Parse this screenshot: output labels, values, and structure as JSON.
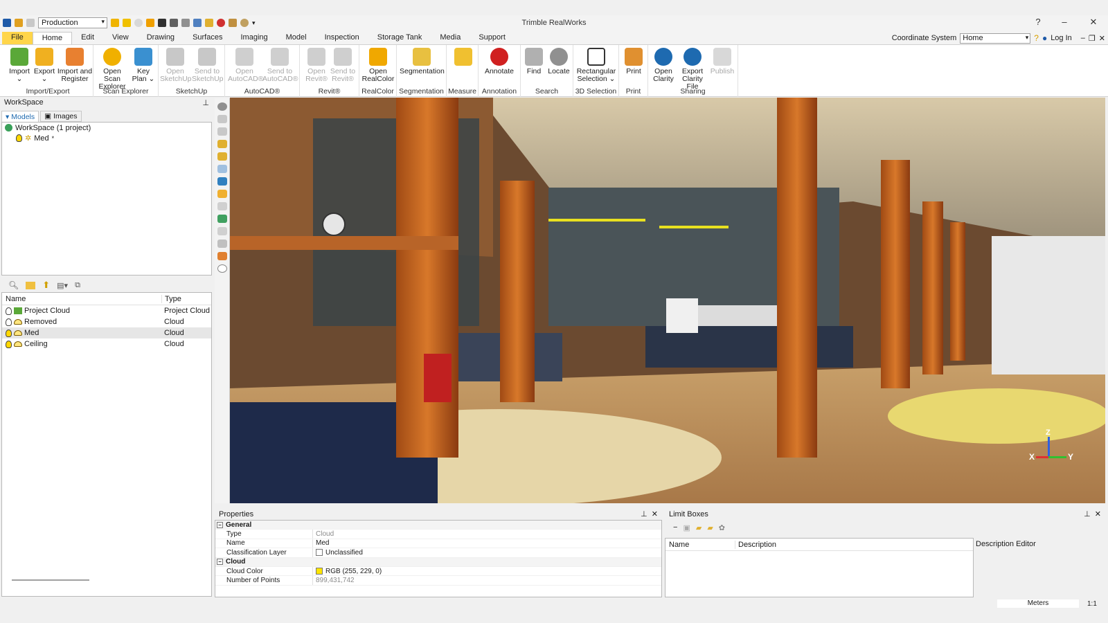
{
  "window": {
    "title": "Trimble RealWorks",
    "preset": "Production"
  },
  "menu": {
    "tabs": [
      "File",
      "Home",
      "Edit",
      "View",
      "Drawing",
      "Surfaces",
      "Imaging",
      "Model",
      "Inspection",
      "Storage Tank",
      "Media",
      "Support"
    ],
    "active": "Home",
    "coordinate_system_label": "Coordinate System",
    "coordinate_system_value": "Home",
    "login": "Log In"
  },
  "ribbon": {
    "groups": [
      {
        "label": "Import/Export",
        "buttons": [
          {
            "l1": "Import",
            "l2": "⌄"
          },
          {
            "l1": "Export",
            "l2": "⌄"
          },
          {
            "l1": "Import and",
            "l2": "Register"
          }
        ]
      },
      {
        "label": "Scan Explorer",
        "buttons": [
          {
            "l1": "Open Scan",
            "l2": "Explorer"
          },
          {
            "l1": "Key",
            "l2": "Plan ⌄"
          }
        ]
      },
      {
        "label": "SketchUp",
        "buttons": [
          {
            "l1": "Open",
            "l2": "SketchUp"
          },
          {
            "l1": "Send to",
            "l2": "SketchUp"
          }
        ]
      },
      {
        "label": "AutoCAD®",
        "buttons": [
          {
            "l1": "Open",
            "l2": "AutoCAD®"
          },
          {
            "l1": "Send to",
            "l2": "AutoCAD®"
          }
        ]
      },
      {
        "label": "Revit®",
        "buttons": [
          {
            "l1": "Open",
            "l2": "Revit®"
          },
          {
            "l1": "Send to",
            "l2": "Revit®"
          }
        ]
      },
      {
        "label": "RealColor",
        "buttons": [
          {
            "l1": "Open",
            "l2": "RealColor"
          }
        ]
      },
      {
        "label": "Segmentation",
        "buttons": [
          {
            "l1": "Segmentation",
            "l2": ""
          }
        ]
      },
      {
        "label": "Measure",
        "buttons": [
          {
            "l1": "",
            "l2": ""
          }
        ]
      },
      {
        "label": "Annotation",
        "buttons": [
          {
            "l1": "Annotate",
            "l2": ""
          }
        ]
      },
      {
        "label": "Search",
        "buttons": [
          {
            "l1": "Find",
            "l2": ""
          },
          {
            "l1": "Locate",
            "l2": ""
          }
        ]
      },
      {
        "label": "3D Selection",
        "buttons": [
          {
            "l1": "Rectangular",
            "l2": "Selection ⌄"
          }
        ]
      },
      {
        "label": "Print",
        "buttons": [
          {
            "l1": "Print",
            "l2": ""
          }
        ]
      },
      {
        "label": "Sharing",
        "buttons": [
          {
            "l1": "Open",
            "l2": "Clarity"
          },
          {
            "l1": "Export",
            "l2": "Clarity File"
          },
          {
            "l1": "Publish",
            "l2": ""
          }
        ]
      }
    ]
  },
  "workspace": {
    "title": "WorkSpace",
    "tabs": [
      "Models",
      "Images"
    ],
    "root": "WorkSpace  (1 project)",
    "child": "Med",
    "child_mark": "*"
  },
  "list": {
    "headers": [
      "Name",
      "Type"
    ],
    "rows": [
      {
        "name": "Project Cloud",
        "type": "Project Cloud"
      },
      {
        "name": "Removed",
        "type": "Cloud"
      },
      {
        "name": "Med",
        "type": "Cloud"
      },
      {
        "name": "Ceiling",
        "type": "Cloud"
      }
    ]
  },
  "properties": {
    "title": "Properties",
    "general": "General",
    "type_key": "Type",
    "type_val": "Cloud",
    "name_key": "Name",
    "name_val": "Med",
    "class_key": "Classification Layer",
    "class_val": "Unclassified",
    "cloud": "Cloud",
    "color_key": "Cloud Color",
    "color_val": "RGB (255, 229, 0)",
    "points_key": "Number of Points",
    "points_val": "899,431,742"
  },
  "limit_boxes": {
    "title": "Limit Boxes",
    "headers": [
      "Name",
      "Description"
    ],
    "description_editor": "Description Editor"
  },
  "status": {
    "units": "Meters",
    "scale": "1:1"
  },
  "axes": {
    "x": "X",
    "y": "Y",
    "z": "Z"
  }
}
